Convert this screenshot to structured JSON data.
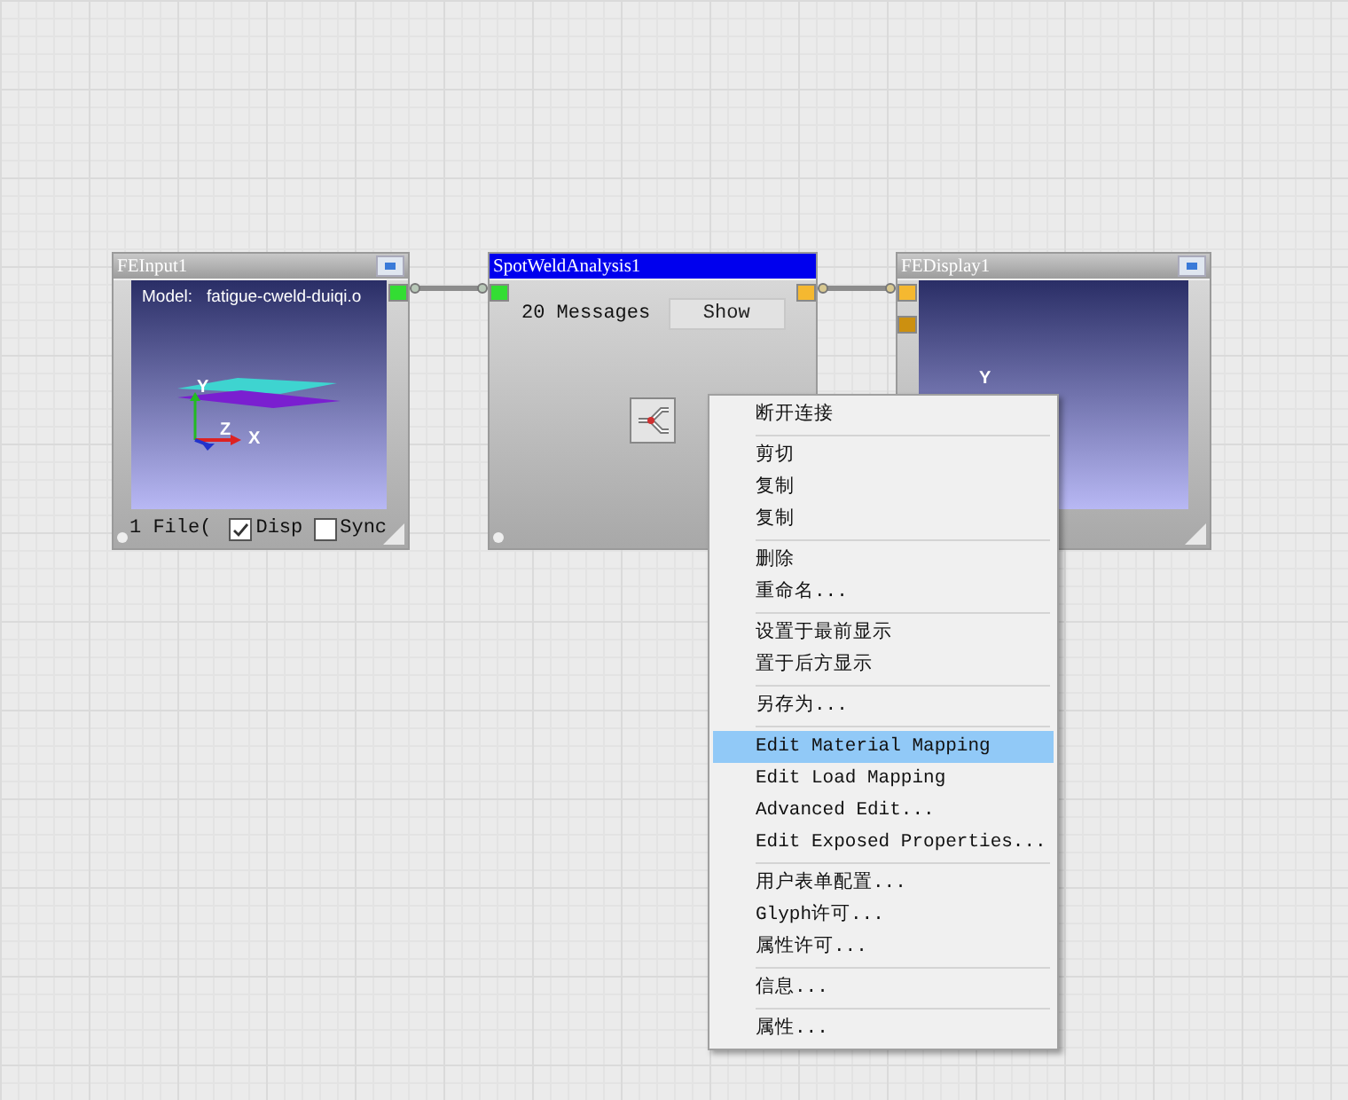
{
  "nodes": [
    {
      "kind": "input",
      "title": "FEInput1",
      "selected": false,
      "model_label": "Model:",
      "model_name": "fatigue-cweld-duiqi.o",
      "axes": [
        "Y",
        "Z",
        "X"
      ],
      "file_count": "1 File(",
      "checkboxes": [
        {
          "label": "Disp",
          "checked": true
        },
        {
          "label": "Sync",
          "checked": false
        }
      ],
      "outputs": [
        {
          "color": "#33dd33"
        }
      ]
    },
    {
      "kind": "analysis",
      "title": "SpotWeldAnalysis1",
      "selected": true,
      "messages": "20 Messages",
      "button": "Show",
      "inputs": [
        {
          "color": "#33dd33"
        }
      ],
      "outputs": [
        {
          "color": "#f5b830"
        }
      ]
    },
    {
      "kind": "display",
      "title": "FEDisplay1",
      "selected": false,
      "axes": [
        "Y"
      ],
      "inputs": [
        {
          "color": "#f5b830"
        },
        {
          "color": "#cc9010"
        }
      ]
    }
  ],
  "context_menu": [
    [
      {
        "label": "断开连接",
        "selected": false
      }
    ],
    [
      {
        "label": "剪切",
        "selected": false
      },
      {
        "label": "复制",
        "selected": false
      },
      {
        "label": "复制",
        "selected": false
      }
    ],
    [
      {
        "label": "删除",
        "selected": false
      },
      {
        "label": "重命名...",
        "selected": false
      }
    ],
    [
      {
        "label": "设置于最前显示",
        "selected": false
      },
      {
        "label": "置于后方显示",
        "selected": false
      }
    ],
    [
      {
        "label": "另存为...",
        "selected": false
      }
    ],
    [
      {
        "label": "Edit Material Mapping",
        "selected": true
      },
      {
        "label": "Edit Load Mapping",
        "selected": false
      },
      {
        "label": "Advanced Edit...",
        "selected": false
      },
      {
        "label": "Edit Exposed Properties...",
        "selected": false
      }
    ],
    [
      {
        "label": "用户表单配置...",
        "selected": false
      },
      {
        "label": "Glyph许可...",
        "selected": false
      },
      {
        "label": "属性许可...",
        "selected": false
      }
    ],
    [
      {
        "label": "信息...",
        "selected": false
      }
    ],
    [
      {
        "label": "属性...",
        "selected": false
      }
    ]
  ]
}
